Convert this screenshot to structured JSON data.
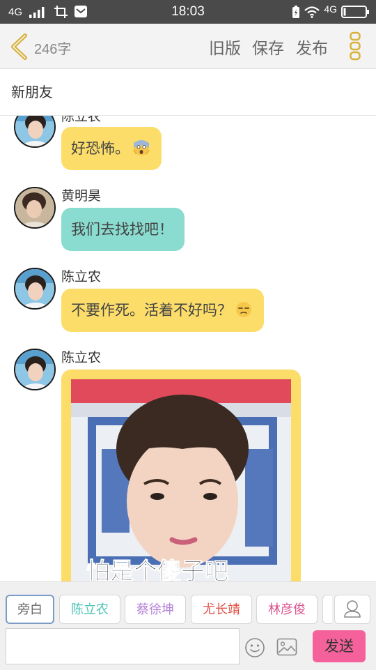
{
  "status_bar": {
    "network": "4G",
    "network_right": "4G",
    "time": "18:03",
    "signal_icon": "signal-bars-icon",
    "battery_icon": "battery-icon",
    "wifi_icon": "wifi-icon"
  },
  "top_bar": {
    "word_count": "246字",
    "old_version": "旧版",
    "save": "保存",
    "publish": "发布",
    "accent_color": "#d8b23a"
  },
  "chat": {
    "title": "新朋友",
    "messages": [
      {
        "sender": "陈立农",
        "text": "好恐怖。",
        "emoji": "scream-emoji",
        "bubble_color": "#fcdd6a"
      },
      {
        "sender": "黄明昊",
        "text": "我们去找找吧！",
        "bubble_color": "#8adbd0"
      },
      {
        "sender": "陈立农",
        "text": "不要作死。活着不好吗？",
        "emoji": "unamused-emoji",
        "bubble_color": "#fcdd6a"
      },
      {
        "sender": "陈立农",
        "type": "image",
        "caption": "怕是个傻子吧",
        "bubble_color": "#fcdd6a"
      }
    ]
  },
  "characters": [
    {
      "label": "旁白",
      "color": "#666666"
    },
    {
      "label": "陈立农",
      "color": "#4cc3b5"
    },
    {
      "label": "蔡徐坤",
      "color": "#b27fd6"
    },
    {
      "label": "尤长靖",
      "color": "#e0524a"
    },
    {
      "label": "林彦俊",
      "color": "#d8558f"
    }
  ],
  "input": {
    "placeholder": "",
    "send_label": "发送",
    "send_color": "#f5629b"
  }
}
